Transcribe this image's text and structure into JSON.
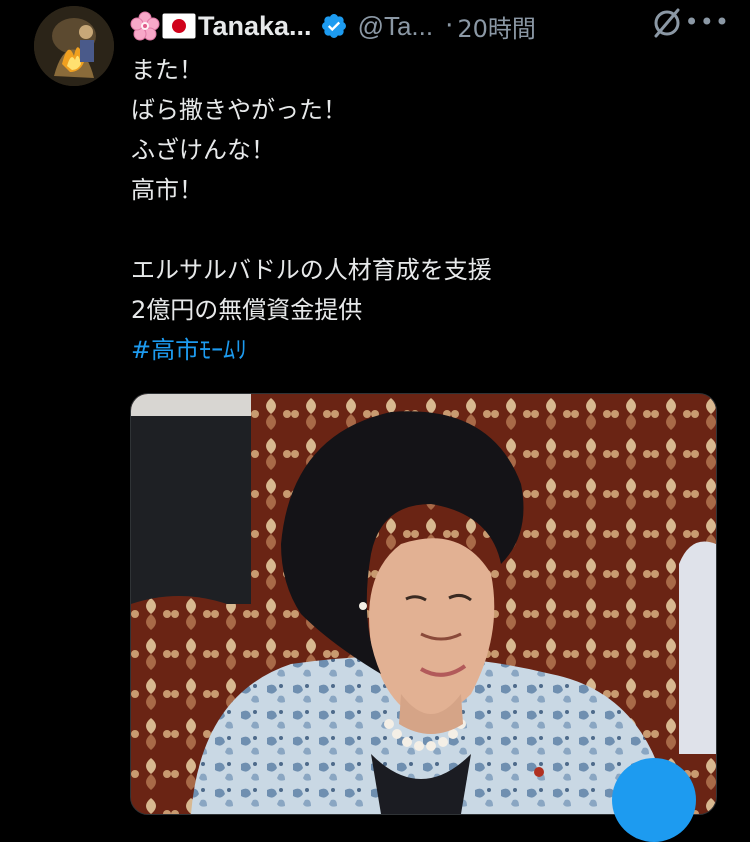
{
  "author": {
    "emoji_badges": [
      "cherry-blossom",
      "japan-flag"
    ],
    "display_name": "Tanaka...",
    "handle": "@Ta...",
    "verified": true,
    "separator": "·",
    "timestamp": "20時間"
  },
  "tweet": {
    "lines": [
      "また！",
      "ばら撒きやがった！",
      "ふざけんな！",
      "高市！",
      "",
      "エルサルバドルの人材育成を支援",
      "2億円の無償資金提供"
    ],
    "hashtag": "#高市ﾓｰﾑﾘ"
  },
  "actions": {
    "more": "•••"
  },
  "colors": {
    "background": "#000000",
    "text": "#e7e9ea",
    "secondary": "#8b98a5",
    "accent": "#1d9bf0"
  }
}
